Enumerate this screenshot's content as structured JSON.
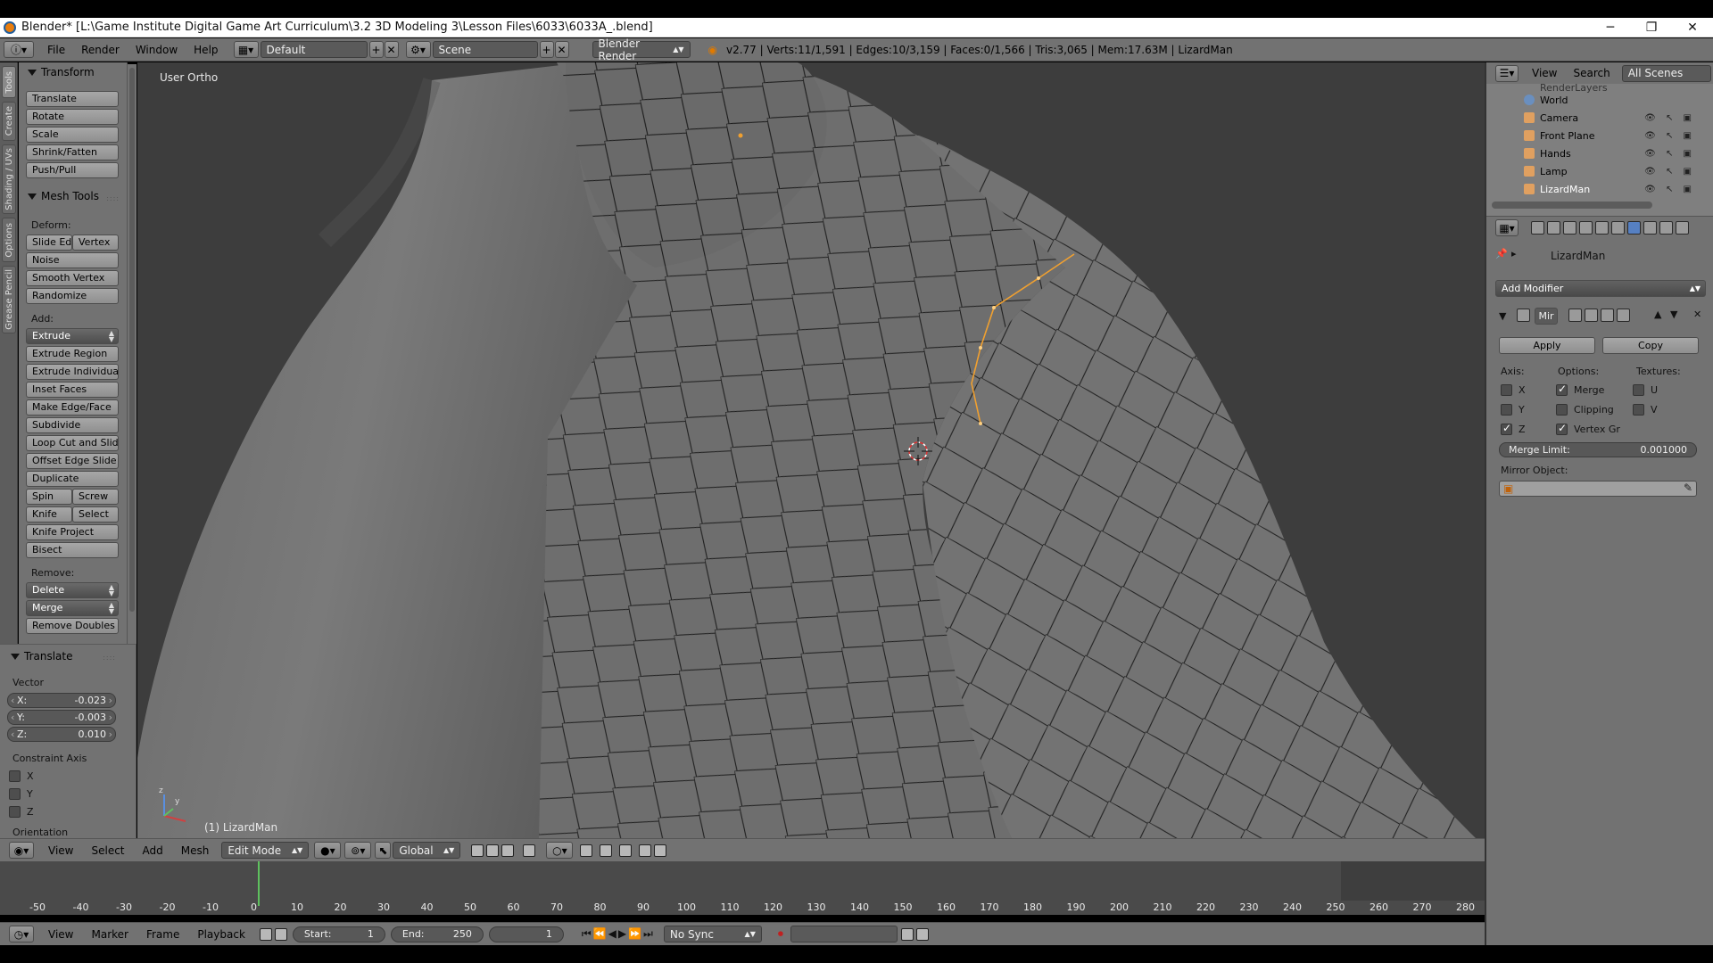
{
  "window": {
    "title": "Blender* [L:\\Game Institute Digital Game Art  Curriculum\\3.2 3D Modeling 3\\Lesson Files\\6033\\6033A_.blend]",
    "controls": [
      "─",
      "❐",
      "✕"
    ]
  },
  "info_header": {
    "menus": [
      "File",
      "Render",
      "Window",
      "Help"
    ],
    "screen_layout": "Default",
    "scene": "Scene",
    "render_engine": "Blender Render",
    "stats": "v2.77 | Verts:11/1,591 | Edges:10/3,159 | Faces:0/1,566 | Tris:3,065 | Mem:17.63M | LizardMan"
  },
  "tool_tabs": [
    "Tools",
    "Create",
    "Shading / UVs",
    "Options",
    "Grease Pencil"
  ],
  "transform_panel": {
    "title": "Transform",
    "buttons": [
      "Translate",
      "Rotate",
      "Scale",
      "Shrink/Fatten",
      "Push/Pull"
    ]
  },
  "mesh_tools_panel": {
    "title": "Mesh Tools",
    "deform_label": "Deform:",
    "slide_edge": "Slide Ed",
    "vertex": "Vertex",
    "deform_buttons": [
      "Noise",
      "Smooth Vertex",
      "Randomize"
    ],
    "add_label": "Add:",
    "extrude": "Extrude",
    "add_buttons": [
      "Extrude Region",
      "Extrude Individual",
      "Inset Faces",
      "Make Edge/Face",
      "Subdivide",
      "Loop Cut and Slide",
      "Offset Edge Slide",
      "Duplicate"
    ],
    "spin": "Spin",
    "screw": "Screw",
    "knife": "Knife",
    "select": "Select",
    "more_buttons": [
      "Knife Project",
      "Bisect"
    ],
    "remove_label": "Remove:",
    "delete": "Delete",
    "merge": "Merge",
    "remove_doubles": "Remove Doubles"
  },
  "translate_op": {
    "title": "Translate",
    "vector_label": "Vector",
    "x_label": "X:",
    "x": "-0.023",
    "y_label": "Y:",
    "y": "-0.003",
    "z_label": "Z:",
    "z": "0.010",
    "constraint_label": "Constraint Axis",
    "axes": [
      "X",
      "Y",
      "Z"
    ],
    "orientation_label": "Orientation"
  },
  "viewport": {
    "view_name": "User Ortho",
    "object_label": "(1) LizardMan"
  },
  "view3d_header": {
    "menus": [
      "View",
      "Select",
      "Add",
      "Mesh"
    ],
    "mode": "Edit Mode",
    "orientation": "Global"
  },
  "timeline": {
    "ticks": [
      -50,
      -40,
      -30,
      -20,
      -10,
      0,
      10,
      20,
      30,
      40,
      50,
      60,
      70,
      80,
      90,
      100,
      110,
      120,
      130,
      140,
      150,
      160,
      170,
      180,
      190,
      200,
      210,
      220,
      230,
      240,
      250,
      260,
      270,
      280
    ],
    "current_frame": 1,
    "menus": [
      "View",
      "Marker",
      "Frame",
      "Playback"
    ],
    "start_label": "Start:",
    "start": "1",
    "end_label": "End:",
    "end": "250",
    "frame": "1",
    "sync": "No Sync"
  },
  "outliner": {
    "menus": [
      "View",
      "Search"
    ],
    "filter": "All Scenes",
    "clipped_row": "RenderLayers",
    "items": [
      "World",
      "Camera",
      "Front Plane",
      "Hands",
      "Lamp",
      "LizardMan"
    ]
  },
  "properties": {
    "object_name": "LizardMan",
    "add_modifier": "Add Modifier",
    "modifier_name": "Mir",
    "apply": "Apply",
    "copy": "Copy",
    "axis_label": "Axis:",
    "options_label": "Options:",
    "textures_label": "Textures:",
    "axis_x": "X",
    "axis_y": "Y",
    "axis_z": "Z",
    "merge": "Merge",
    "clipping": "Clipping",
    "vertex_group": "Vertex Gr",
    "tex_u": "U",
    "tex_v": "V",
    "merge_limit_label": "Merge Limit:",
    "merge_limit": "0.001000",
    "mirror_object_label": "Mirror Object:"
  },
  "colors": {
    "panel": "#727272",
    "viewport_bg": "#3d3d3d",
    "selection": "#f0a030",
    "timeline_cursor": "#5ec15e"
  }
}
